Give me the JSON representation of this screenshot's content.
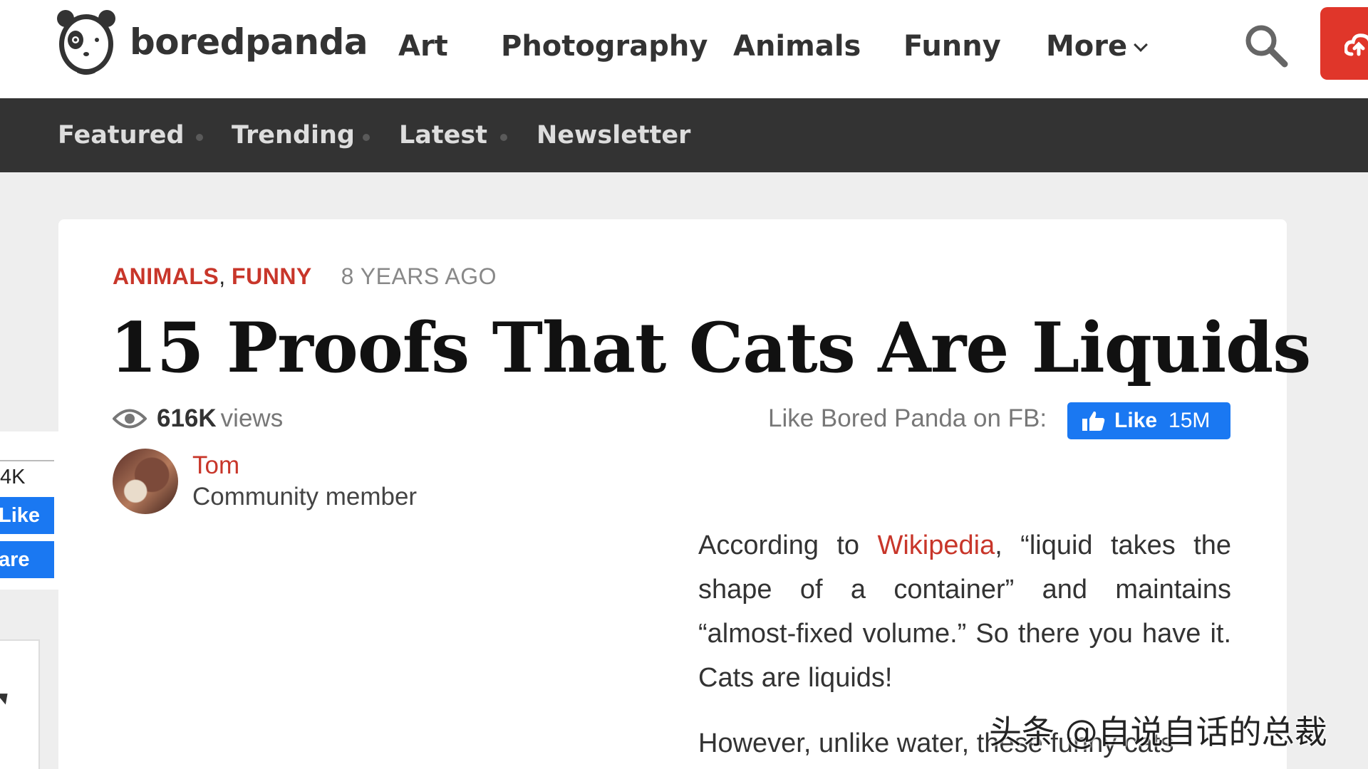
{
  "header": {
    "logo_text": "boredpanda",
    "nav": [
      {
        "label": "Art"
      },
      {
        "label": "Photography"
      },
      {
        "label": "Animals"
      },
      {
        "label": "Funny"
      },
      {
        "label": "More"
      }
    ]
  },
  "subnav": {
    "items": [
      {
        "label": "Featured"
      },
      {
        "label": "Trending"
      },
      {
        "label": "Latest"
      },
      {
        "label": "Newsletter"
      }
    ]
  },
  "article": {
    "categories": [
      "ANIMALS",
      "FUNNY"
    ],
    "separator": ",",
    "time_ago": "8 YEARS AGO",
    "title": "15 Proofs That Cats Are Liquids",
    "views_count": "616K",
    "views_label": "views",
    "fb_prompt": "Like Bored Panda on FB:",
    "fb_like_label": "Like",
    "fb_like_count": "15M",
    "author_name": "Tom",
    "author_role": "Community member",
    "p1_before": "According to ",
    "p1_link": "Wikipedia",
    "p1_after": ", “liquid takes the shape of a container” and maintains “almost-fixed volume.” So there you have it. Cats are liquids!",
    "p2": "However, unlike water, these funny cats"
  },
  "share": {
    "count": "4K",
    "like_label": "Like",
    "share_label": "are"
  },
  "watermark": "头条 @自说自话的总裁",
  "colors": {
    "accent": "#c8362a",
    "subnav_bg": "#333333",
    "fb_blue": "#1a78f2",
    "upload_red": "#e0362a"
  }
}
